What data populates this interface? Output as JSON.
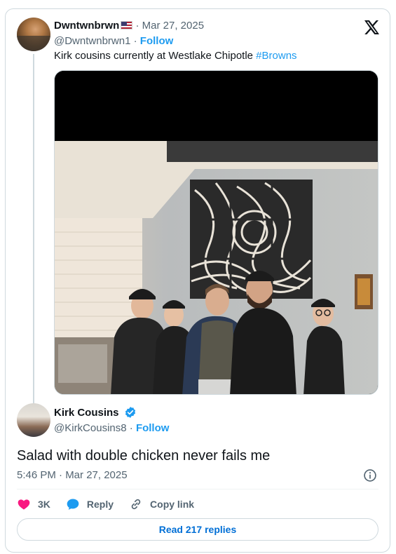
{
  "quoted_tweet": {
    "display_name": "Dwntwnbrwn",
    "flag": "🇺🇸",
    "date": "· Mar 27, 2025",
    "handle": "@Dwntwnbrwn1",
    "separator": "·",
    "follow_label": "Follow",
    "text": "Kirk cousins currently at Westlake Chipotle ",
    "hashtag": "#Browns"
  },
  "main_tweet": {
    "display_name": "Kirk Cousins",
    "handle": "@KirkCousins8",
    "separator": "·",
    "follow_label": "Follow",
    "text": "Salad with double chicken never fails me",
    "timestamp": "5:46 PM · Mar 27, 2025"
  },
  "actions": {
    "like_count": "3K",
    "reply_label": "Reply",
    "copy_link_label": "Copy link"
  },
  "read_replies_label": "Read 217 replies",
  "colors": {
    "accent": "#1d9bf0",
    "link_button": "#006fd6",
    "like": "#f91880",
    "muted": "#536471",
    "border": "#cfd9de"
  },
  "icons": [
    "x-logo-icon",
    "verified-badge-icon",
    "info-icon",
    "heart-icon",
    "reply-bubble-icon",
    "link-icon"
  ]
}
